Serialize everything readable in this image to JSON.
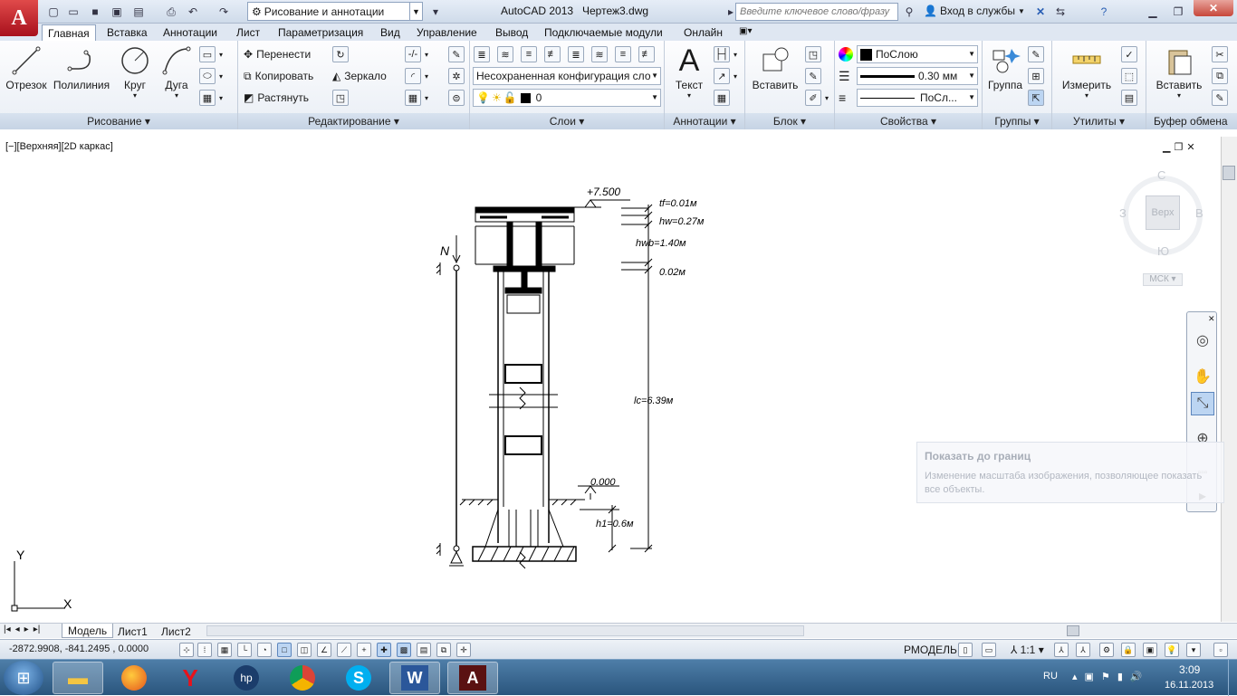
{
  "titlebar": {
    "app_logo_letter": "A",
    "workspace": "Рисование и аннотации",
    "app_name": "AutoCAD 2013",
    "file_name": "Чертеж3.dwg",
    "search_placeholder": "Введите ключевое слово/фразу",
    "signin": "Вход в службы"
  },
  "tabs": [
    "Главная",
    "Вставка",
    "Аннотации",
    "Лист",
    "Параметризация",
    "Вид",
    "Управление",
    "Вывод",
    "Подключаемые модули",
    "Онлайн"
  ],
  "ribbon": {
    "draw": {
      "title": "Рисование",
      "line": "Отрезок",
      "polyline": "Полилиния",
      "circle": "Круг",
      "arc": "Дуга"
    },
    "modify": {
      "title": "Редактирование",
      "move": "Перенести",
      "copy": "Копировать",
      "stretch": "Растянуть",
      "mirror": "Зеркало"
    },
    "layers": {
      "title": "Слои",
      "layer_state": "Несохраненная конфигурация сло",
      "current_layer": "0"
    },
    "annotation": {
      "title": "Аннотации",
      "text": "Текст"
    },
    "block": {
      "title": "Блок",
      "insert": "Вставить"
    },
    "properties": {
      "title": "Свойства",
      "color": "ПоСлою",
      "lineweight": "0.30 мм",
      "linetype": "ПоСл..."
    },
    "groups": {
      "title": "Группы",
      "group": "Группа"
    },
    "utilities": {
      "title": "Утилиты",
      "measure": "Измерить"
    },
    "clipboard": {
      "title": "Буфер обмена",
      "paste": "Вставить"
    }
  },
  "viewport": {
    "label": "[−][Верхняя][2D каркас]",
    "viewcube": {
      "north": "С",
      "south": "Ю",
      "west": "З",
      "east": "В",
      "face": "Верх",
      "ucs": "МСК"
    },
    "ucs_x": "X",
    "ucs_y": "Y"
  },
  "drawing": {
    "elev_top": "+7.500",
    "tf": "tf=0.01м",
    "hw": "hw=0.27м",
    "hwb": "hwb=1.40м",
    "gap": "0.02м",
    "lc": "lc=6.39м",
    "zero": "0.000",
    "h1": "h1=0.6м",
    "load": "N"
  },
  "tooltip": {
    "title": "Показать до границ",
    "text": "Изменение масштаба изображения, позволяющее показать все объекты."
  },
  "layout_tabs": [
    "Модель",
    "Лист1",
    "Лист2"
  ],
  "status": {
    "coords": "-2872.9908, -841.2495 , 0.0000",
    "space": "РМОДЕЛЬ",
    "scale": "1:1"
  },
  "taskbar": {
    "lang": "RU",
    "time": "3:09",
    "date": "16.11.2013"
  },
  "colors": {
    "autocad_red": "#c8102e",
    "ribbon_bg": "#e9eef5",
    "taskbar": "#2a557d"
  }
}
